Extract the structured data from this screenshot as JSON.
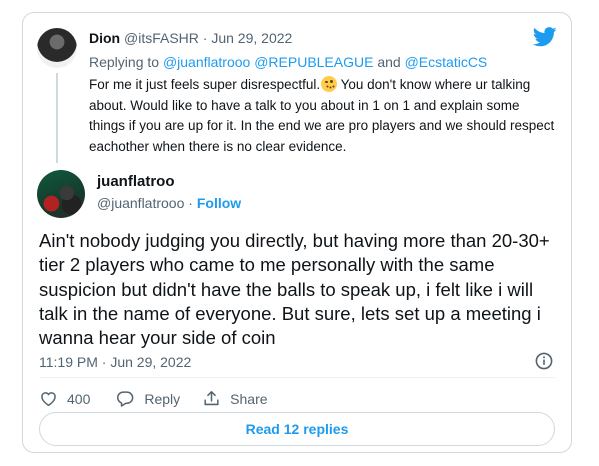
{
  "parent_tweet": {
    "name": "Dion",
    "handle": "@itsFASHR",
    "separator": "·",
    "date": "Jun 29, 2022",
    "replying_to_prefix": "Replying to",
    "replying_to_mentions": "@juanflatrooo @REPUBLEAGUE",
    "replying_to_and": "and",
    "replying_to_last": "@EcstaticCS",
    "text_before_emoji": "For me it just feels super disrespectful.",
    "emoji": "smirking-face-emoji",
    "text_after_emoji": " You don't know where ur talking about. Would like to have a talk to you about in 1 on 1 and explain some things if you are up for it. In the end we are pro players and we should respect eachother when there is no clear evidence."
  },
  "main_tweet": {
    "name": "juanflatroo",
    "handle": "@juanflatrooo",
    "separator": "·",
    "follow_label": "Follow",
    "text": "Ain't nobody judging you directly, but having more than 20-30+ tier 2  players who came to me personally with the same suspicion but didn't have the balls to speak up, i felt like i will talk in the name of everyone. But sure, lets set up a meeting i wanna hear your side of coin",
    "timestamp": "11:19 PM · Jun 29, 2022"
  },
  "actions": {
    "like_count": "400",
    "reply_label": "Reply",
    "share_label": "Share"
  },
  "read_replies_label": "Read 12 replies",
  "colors": {
    "accent": "#1d9bf0",
    "text": "#0f1419",
    "muted": "#536471",
    "border": "#cfd9de"
  }
}
